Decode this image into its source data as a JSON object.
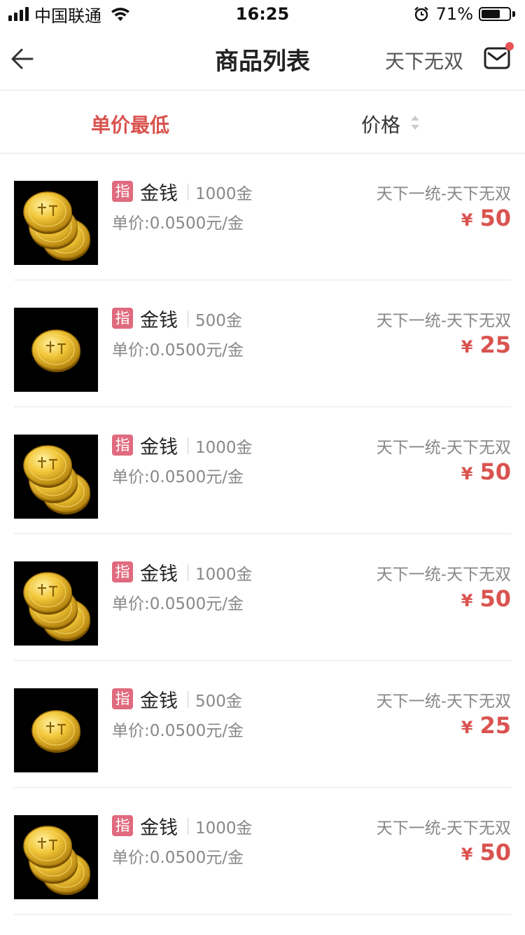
{
  "status_bar": {
    "carrier": "中国联通",
    "time": "16:25",
    "battery_percent": "71%",
    "battery_level": 0.71
  },
  "nav": {
    "title": "商品列表",
    "server": "天下无双",
    "back_icon": "arrow-left-icon",
    "mail_icon": "mail-icon"
  },
  "sort": {
    "lowest_unit_price": "单价最低",
    "price": "价格"
  },
  "colors": {
    "accent": "#d9534f",
    "badge": "#e06a7e"
  },
  "items": [
    {
      "badge": "指",
      "name": "金钱",
      "amount": "1000金",
      "unit_price": "单价:0.0500元/金",
      "server": "天下一统-天下无双",
      "currency": "¥",
      "price": "50",
      "coins": 3
    },
    {
      "badge": "指",
      "name": "金钱",
      "amount": "500金",
      "unit_price": "单价:0.0500元/金",
      "server": "天下一统-天下无双",
      "currency": "¥",
      "price": "25",
      "coins": 1
    },
    {
      "badge": "指",
      "name": "金钱",
      "amount": "1000金",
      "unit_price": "单价:0.0500元/金",
      "server": "天下一统-天下无双",
      "currency": "¥",
      "price": "50",
      "coins": 3
    },
    {
      "badge": "指",
      "name": "金钱",
      "amount": "1000金",
      "unit_price": "单价:0.0500元/金",
      "server": "天下一统-天下无双",
      "currency": "¥",
      "price": "50",
      "coins": 3
    },
    {
      "badge": "指",
      "name": "金钱",
      "amount": "500金",
      "unit_price": "单价:0.0500元/金",
      "server": "天下一统-天下无双",
      "currency": "¥",
      "price": "25",
      "coins": 1
    },
    {
      "badge": "指",
      "name": "金钱",
      "amount": "1000金",
      "unit_price": "单价:0.0500元/金",
      "server": "天下一统-天下无双",
      "currency": "¥",
      "price": "50",
      "coins": 3
    }
  ]
}
